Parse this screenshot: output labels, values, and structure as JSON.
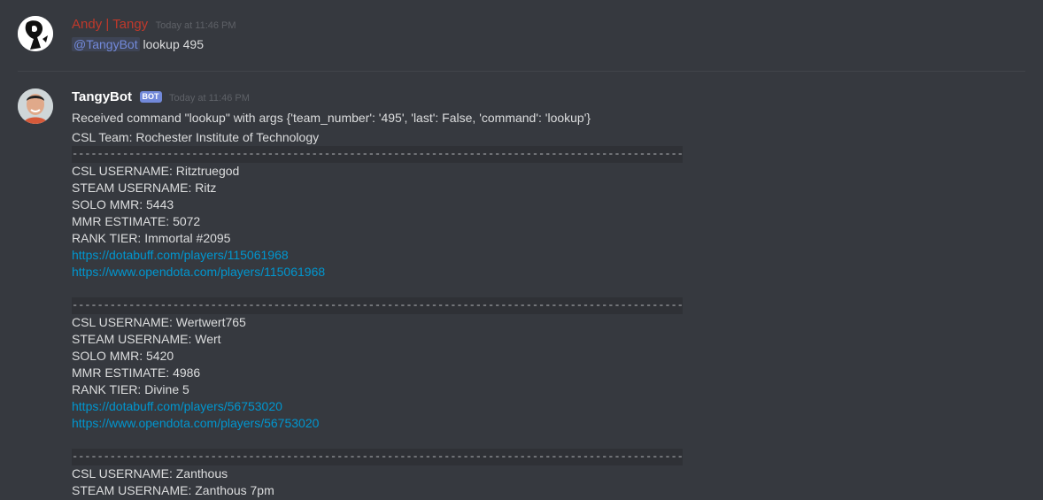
{
  "message1": {
    "username": "Andy | Tangy",
    "username_color": "#c0392b",
    "timestamp": "Today at 11:46 PM",
    "mention": "@TangyBot",
    "text": " lookup 495"
  },
  "message2": {
    "username": "TangyBot",
    "bot_tag": "BOT",
    "timestamp": "Today at 11:46 PM",
    "line1": "Received command \"lookup\" with args {'team_number': '495', 'last': False, 'command': 'lookup'}",
    "line2": "CSL Team: Rochester Institute of Technology",
    "separator": "------------------------------------------------------------------------------------------------------------------------------------",
    "players": [
      {
        "csl": "CSL USERNAME:   Ritztruegod",
        "steam": "STEAM USERNAME: Ritz",
        "solo": "SOLO MMR: 5443",
        "estimate": "MMR ESTIMATE: 5072",
        "rank": "RANK TIER: Immortal #2095",
        "dotabuff": "https://dotabuff.com/players/115061968",
        "opendota": "https://www.opendota.com/players/115061968"
      },
      {
        "csl": "CSL USERNAME:   Wertwert765",
        "steam": "STEAM USERNAME: Wert",
        "solo": "SOLO MMR: 5420",
        "estimate": "MMR ESTIMATE: 4986",
        "rank": "RANK TIER: Divine 5",
        "dotabuff": "https://dotabuff.com/players/56753020",
        "opendota": "https://www.opendota.com/players/56753020"
      },
      {
        "csl": "CSL USERNAME:   Zanthous",
        "steam": "STEAM USERNAME: Zanthous 7pm"
      }
    ]
  }
}
